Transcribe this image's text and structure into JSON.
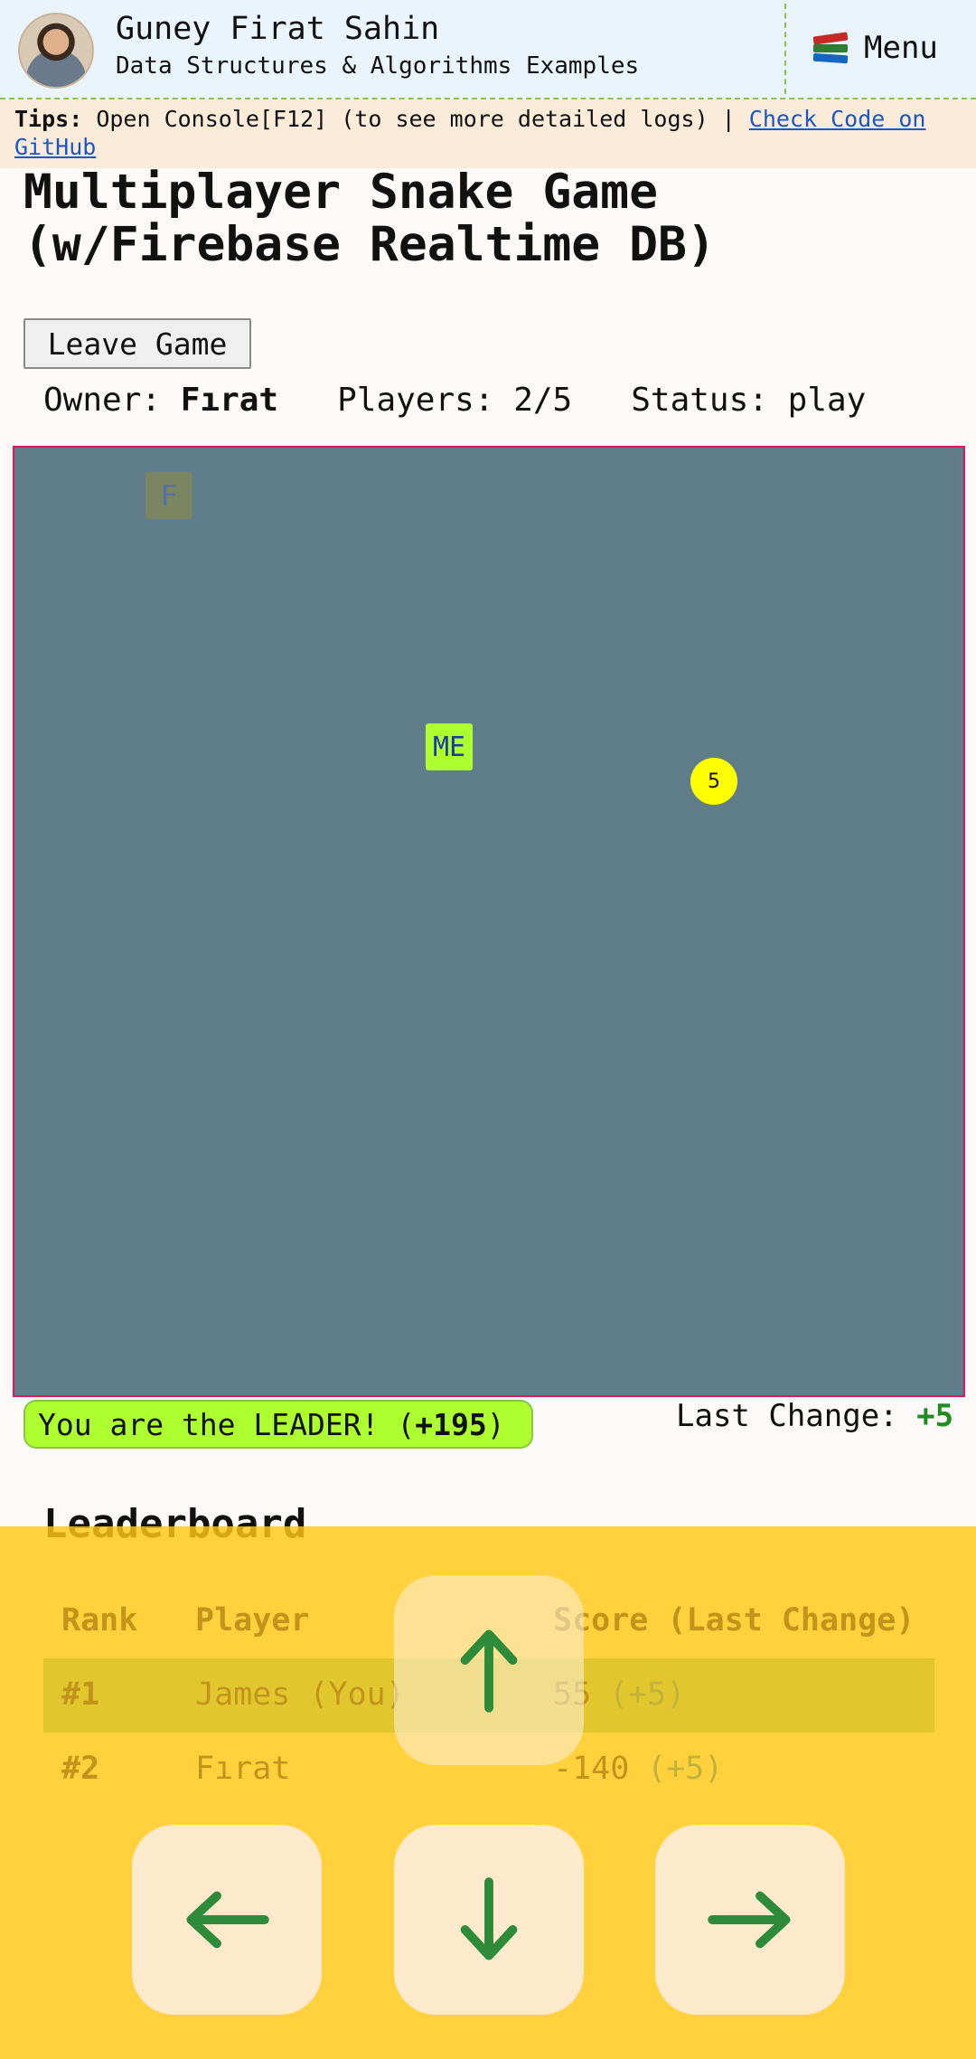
{
  "header": {
    "author": "Guney Firat Sahin",
    "subtitle": "Data Structures & Algorithms Examples",
    "menu_label": "Menu",
    "menu_icon": "books-icon"
  },
  "tips": {
    "label": "Tips:",
    "text": " Open Console[F12] (to see more detailed logs) | ",
    "link": "Check Code on GitHub"
  },
  "page": {
    "title": "Multiplayer Snake Game (w/Firebase Realtime DB)",
    "leave_button": "Leave Game"
  },
  "game_info": {
    "owner_label": "Owner: ",
    "owner": "Fırat",
    "players_label": "   Players: ",
    "players": "2/5",
    "status_label": "   Status: ",
    "status": "play"
  },
  "board": {
    "background": "#607d8b",
    "snakes": [
      {
        "label": "F",
        "color": "#7b8561"
      },
      {
        "label": "ME",
        "color": "#adff2f"
      }
    ],
    "food": {
      "value": "5",
      "color": "#ffff00"
    }
  },
  "status_bar": {
    "leader_text": "You are the LEADER! (",
    "leader_value": "+195",
    "leader_close": ")",
    "last_change_label": "Last Change: ",
    "last_change_value": "+5"
  },
  "leaderboard": {
    "title": "Leaderboard",
    "columns": [
      "Rank",
      "Player",
      "Score (Last Change)"
    ],
    "rows": [
      {
        "rank": "#1",
        "player": "James (You)",
        "score": "55",
        "change": "(+5)"
      },
      {
        "rank": "#2",
        "player": "Fırat",
        "score": "-140",
        "change": "(+5)"
      }
    ]
  },
  "controls": {
    "up": "arrow-up-icon",
    "left": "arrow-left-icon",
    "down": "arrow-down-icon",
    "right": "arrow-right-icon",
    "arrow_color": "#2e8b3a"
  }
}
